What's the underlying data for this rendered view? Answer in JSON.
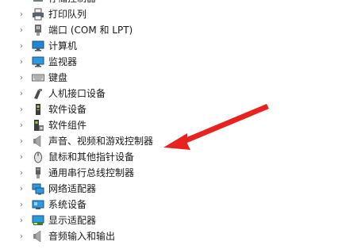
{
  "tree": {
    "items": [
      {
        "label": "打印队列"
      },
      {
        "label": "端口 (COM 和 LPT)"
      },
      {
        "label": "计算机"
      },
      {
        "label": "监视器"
      },
      {
        "label": "键盘"
      },
      {
        "label": "人机接口设备"
      },
      {
        "label": "软件设备"
      },
      {
        "label": "软件组件"
      },
      {
        "label": "声音、视频和游戏控制器"
      },
      {
        "label": "鼠标和其他指针设备"
      },
      {
        "label": "通用串行总线控制器"
      },
      {
        "label": "网络适配器"
      },
      {
        "label": "系统设备"
      },
      {
        "label": "显示适配器"
      },
      {
        "label": "音频输入和输出"
      }
    ],
    "chevron": "›",
    "top_partial_label": "存储控制器"
  },
  "annotation": {
    "arrow_color": "#e8231f"
  }
}
